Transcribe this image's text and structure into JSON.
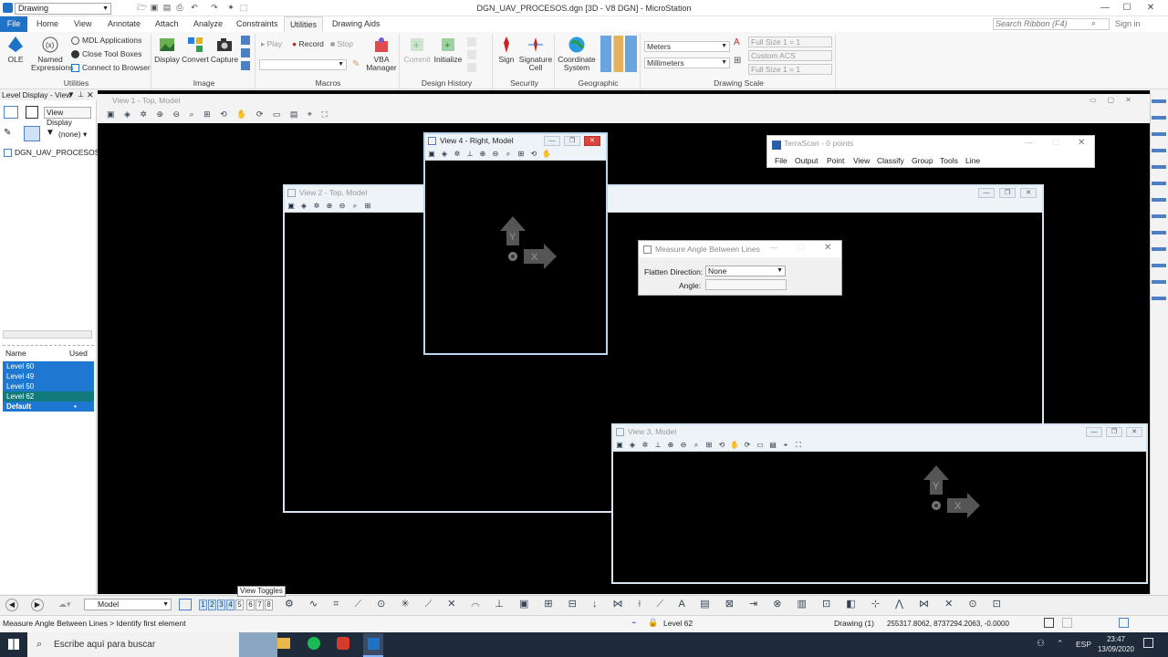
{
  "window": {
    "workspace_select": "Drawing",
    "title": "DGN_UAV_PROCESOS.dgn [3D - V8 DGN] - MicroStation",
    "controls": [
      "—",
      "☐",
      "✕"
    ]
  },
  "ribbon_tabs": [
    "File",
    "Home",
    "View",
    "Annotate",
    "Attach",
    "Analyze",
    "Constraints",
    "Utilities",
    "Drawing Aids"
  ],
  "active_tab": "Utilities",
  "search_ribbon": "Search Ribbon (F4)",
  "sign_in": "Sign in",
  "groups": {
    "utilities": {
      "label": "Utilities",
      "ole": "OLE",
      "named_expressions": "Named Expressions",
      "mdl_applications": "MDL Applications",
      "close_tool_boxes": "Close Tool Boxes",
      "connect_to_browser": "Connect to Browser"
    },
    "image": {
      "label": "Image",
      "display": "Display",
      "convert": "Convert",
      "capture": "Capture"
    },
    "macros": {
      "label": "Macros",
      "play": "Play",
      "record": "Record",
      "stop": "Stop",
      "vba_manager": "VBA Manager"
    },
    "design_history": {
      "label": "Design History",
      "commit": "Commit",
      "initialize": "Initialize"
    },
    "security": {
      "label": "Security",
      "sign": "Sign",
      "signature_cell": "Signature Cell"
    },
    "geographic": {
      "label": "Geographic",
      "coordinate_system": "Coordinate System"
    },
    "drawing_scale": {
      "label": "Drawing Scale",
      "units_master": "Meters",
      "units_sub": "Millimeters",
      "scale1": "Full Size 1 = 1",
      "acs": "Custom ACS",
      "scale2": "Full Size 1 = 1"
    }
  },
  "level_display": {
    "title": "Level Display - View",
    "view_display_button": "View Display",
    "filter": "(none)",
    "tree_item": "DGN_UAV_PROCESOS...",
    "col_name": "Name",
    "col_used": "Used",
    "levels": [
      {
        "name": "Level 60",
        "used": ""
      },
      {
        "name": "Level 49",
        "used": ""
      },
      {
        "name": "Level 50",
        "used": ""
      },
      {
        "name": "Level 62",
        "used": ""
      },
      {
        "name": "Default",
        "used": "•"
      }
    ]
  },
  "views": {
    "view1": "View 1 - Top, Model",
    "view2": "View 2 - Top, Model",
    "view3": "View 3, Model",
    "view4": "View 4 - Right, Model"
  },
  "terrascan": {
    "title": "TerraScan - 0 points",
    "menu": [
      "File",
      "Output",
      "Point",
      "View",
      "Classify",
      "Group",
      "Tools",
      "Line"
    ]
  },
  "measure_dialog": {
    "title": "Measure Angle Between Lines",
    "flatten_label": "Flatten Direction:",
    "flatten_value": "None",
    "angle_label": "Angle:",
    "angle_value": ""
  },
  "bottom": {
    "model_select": "Model",
    "view_numbers": [
      "1",
      "2",
      "3",
      "4",
      "5",
      "6",
      "7",
      "8"
    ],
    "tooltip": "View Toggles"
  },
  "status": {
    "prompt": "Measure Angle Between Lines > Identify first element",
    "level": "Level 62",
    "model": "Drawing (1)",
    "coords": "255317.8062, 8737294.2063, -0.0000"
  },
  "taskbar": {
    "search_placeholder": "Escribe aquí para buscar",
    "lang": "ESP",
    "time": "23:47",
    "date": "13/09/2020"
  },
  "colors": {
    "accent": "#1e73c6",
    "selection": "#1e78d2",
    "view_bg": "#000000"
  }
}
